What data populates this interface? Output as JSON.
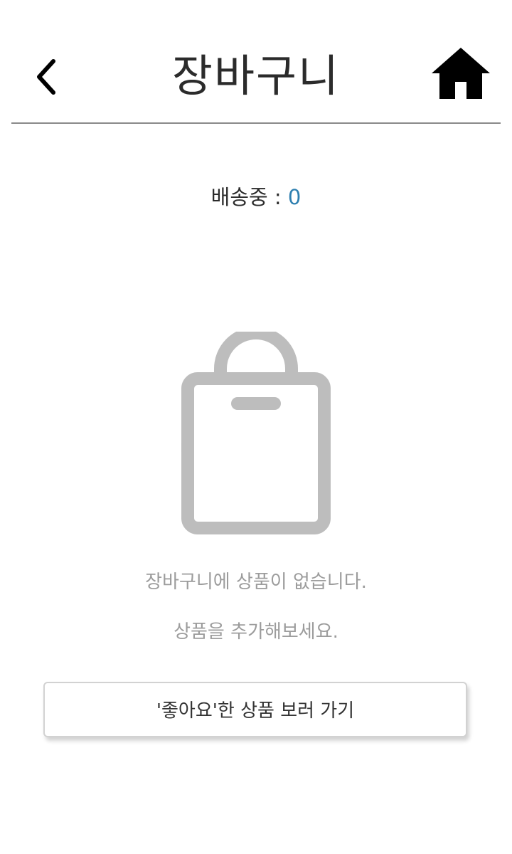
{
  "header": {
    "title": "장바구니",
    "back_icon": "chevron-left-icon",
    "home_icon": "home-icon"
  },
  "shipping": {
    "label": "배송중 : ",
    "count": "0",
    "count_color": "#2e7fb0"
  },
  "empty_state": {
    "icon": "shopping-bag-icon",
    "icon_color": "#bdbdbd",
    "message_line1": "장바구니에 상품이 없습니다.",
    "message_line2": "상품을 추가해보세요."
  },
  "liked_button": {
    "label": "'좋아요'한 상품 보러 가기"
  }
}
